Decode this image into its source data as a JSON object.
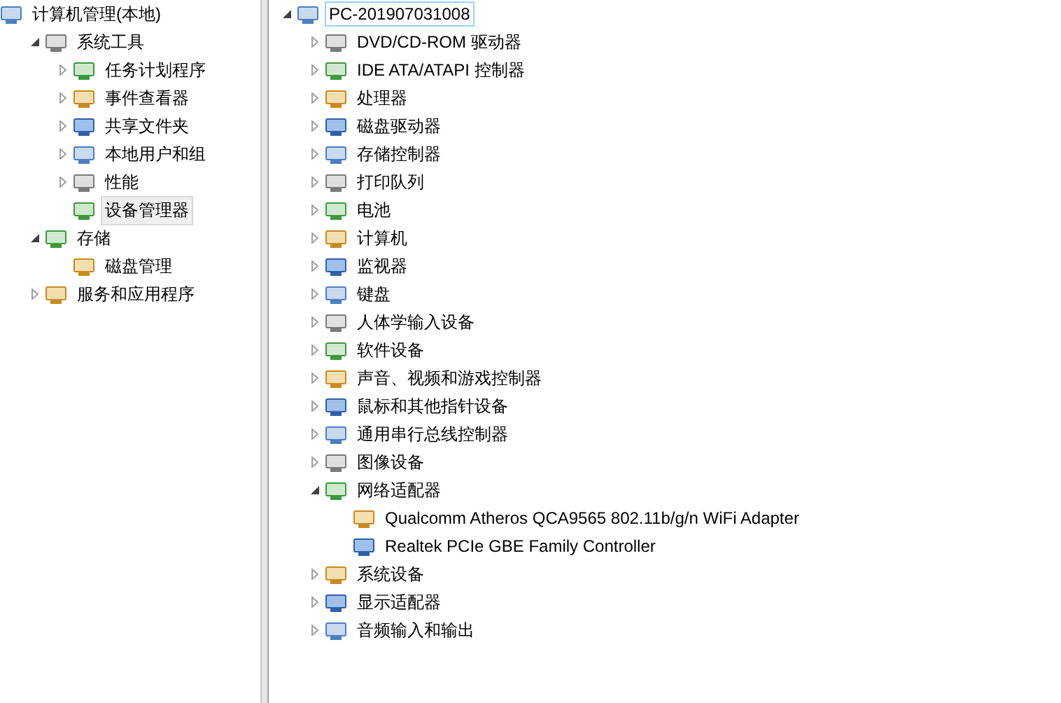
{
  "left_tree": [
    {
      "label": "计算机管理(本地)",
      "selected": false,
      "children": [
        {
          "label": "系统工具",
          "expanded": true,
          "selected": false,
          "children": [
            {
              "label": "任务计划程序",
              "expanded": false,
              "selected": false
            },
            {
              "label": "事件查看器",
              "expanded": false,
              "selected": false
            },
            {
              "label": "共享文件夹",
              "expanded": false,
              "selected": false
            },
            {
              "label": "本地用户和组",
              "expanded": false,
              "selected": false
            },
            {
              "label": "性能",
              "expanded": false,
              "selected": false
            },
            {
              "label": "设备管理器",
              "selected": true
            }
          ]
        },
        {
          "label": "存储",
          "expanded": true,
          "selected": false,
          "children": [
            {
              "label": "磁盘管理",
              "selected": false
            }
          ]
        },
        {
          "label": "服务和应用程序",
          "expanded": false,
          "selected": false
        }
      ]
    }
  ],
  "device_tree": [
    {
      "label": "PC-201907031008",
      "expanded": true,
      "selected": true,
      "children": [
        {
          "label": "DVD/CD-ROM 驱动器",
          "expanded": false,
          "selected": false
        },
        {
          "label": "IDE ATA/ATAPI 控制器",
          "expanded": false,
          "selected": false
        },
        {
          "label": "处理器",
          "expanded": false,
          "selected": false
        },
        {
          "label": "磁盘驱动器",
          "expanded": false,
          "selected": false
        },
        {
          "label": "存储控制器",
          "expanded": false,
          "selected": false
        },
        {
          "label": "打印队列",
          "expanded": false,
          "selected": false
        },
        {
          "label": "电池",
          "expanded": false,
          "selected": false
        },
        {
          "label": "计算机",
          "expanded": false,
          "selected": false
        },
        {
          "label": "监视器",
          "expanded": false,
          "selected": false
        },
        {
          "label": "键盘",
          "expanded": false,
          "selected": false
        },
        {
          "label": "人体学输入设备",
          "expanded": false,
          "selected": false
        },
        {
          "label": "软件设备",
          "expanded": false,
          "selected": false
        },
        {
          "label": "声音、视频和游戏控制器",
          "expanded": false,
          "selected": false
        },
        {
          "label": "鼠标和其他指针设备",
          "expanded": false,
          "selected": false
        },
        {
          "label": "通用串行总线控制器",
          "expanded": false,
          "selected": false
        },
        {
          "label": "图像设备",
          "expanded": false,
          "selected": false
        },
        {
          "label": "网络适配器",
          "expanded": true,
          "selected": false,
          "children": [
            {
              "label": "Qualcomm Atheros QCA9565 802.11b/g/n WiFi Adapter",
              "selected": false
            },
            {
              "label": "Realtek PCIe GBE Family Controller",
              "selected": false
            }
          ]
        },
        {
          "label": "系统设备",
          "expanded": false,
          "selected": false
        },
        {
          "label": "显示适配器",
          "expanded": false,
          "selected": false
        },
        {
          "label": "音频输入和输出",
          "expanded": false,
          "selected": false
        }
      ]
    }
  ]
}
